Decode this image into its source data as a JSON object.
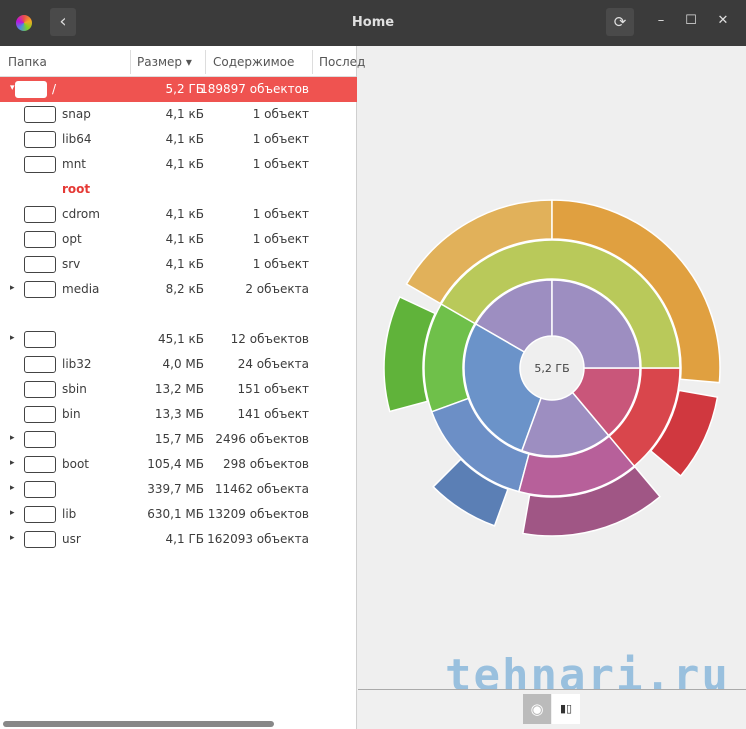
{
  "header": {
    "title": "Home",
    "back_icon": "‹",
    "refresh_icon": "⟳",
    "min": "–",
    "max": "☐",
    "close": "✕"
  },
  "columns": {
    "folder": "Папка",
    "size": "Размер ▾",
    "contents": "Содержимое",
    "modified": "Послед"
  },
  "rows": [
    {
      "name": "/",
      "size": "5,2 ГБ",
      "count": "189897 объектов",
      "expander": "▾",
      "selected": true
    },
    {
      "name": "snap",
      "size": "4,1 кБ",
      "count": "1 объект"
    },
    {
      "name": "lib64",
      "size": "4,1 кБ",
      "count": "1 объект"
    },
    {
      "name": "mnt",
      "size": "4,1 кБ",
      "count": "1 объект"
    },
    {
      "name": "root",
      "size": "",
      "count": "",
      "noicon": true
    },
    {
      "name": "cdrom",
      "size": "4,1 кБ",
      "count": "1 объект"
    },
    {
      "name": "opt",
      "size": "4,1 кБ",
      "count": "1 объект"
    },
    {
      "name": "srv",
      "size": "4,1 кБ",
      "count": "1 объект"
    },
    {
      "name": "media",
      "size": "8,2 кБ",
      "count": "2 объекта",
      "expander": "▸"
    },
    {
      "name": "",
      "size": "",
      "count": "",
      "blank": true
    },
    {
      "name": "",
      "size": "45,1 кБ",
      "count": "12 объектов",
      "expander": "▸"
    },
    {
      "name": "lib32",
      "size": "4,0 МБ",
      "count": "24 объекта"
    },
    {
      "name": "sbin",
      "size": "13,2 МБ",
      "count": "151 объект"
    },
    {
      "name": "bin",
      "size": "13,3 МБ",
      "count": "141 объект"
    },
    {
      "name": "",
      "size": "15,7 МБ",
      "count": "2496 объектов",
      "expander": "▸"
    },
    {
      "name": "boot",
      "size": "105,4 МБ",
      "count": "298 объектов",
      "expander": "▸"
    },
    {
      "name": "",
      "size": "339,7 МБ",
      "count": "11462 объекта",
      "expander": "▸"
    },
    {
      "name": "lib",
      "size": "630,1 МБ",
      "count": "13209 объектов",
      "expander": "▸"
    },
    {
      "name": "usr",
      "size": "4,1 ГБ",
      "count": "162093 объекта",
      "expander": "▸"
    }
  ],
  "chart": {
    "center_label": "5,2 ГБ",
    "rings": [
      [
        {
          "start": 0,
          "end": 90,
          "color": "#9d8ec1"
        },
        {
          "start": 90,
          "end": 140,
          "color": "#c9567a"
        },
        {
          "start": 140,
          "end": 200,
          "color": "#9d8ec1"
        },
        {
          "start": 200,
          "end": 300,
          "color": "#6b93c9"
        },
        {
          "start": 300,
          "end": 360,
          "color": "#9d8ec1"
        }
      ],
      [
        {
          "start": -60,
          "end": 90,
          "color": "#b9c95a"
        },
        {
          "start": 90,
          "end": 140,
          "color": "#d9464c"
        },
        {
          "start": 140,
          "end": 195,
          "color": "#b7609a"
        },
        {
          "start": 195,
          "end": 250,
          "color": "#6c8fc6"
        },
        {
          "start": 250,
          "end": 300,
          "color": "#6fc04a"
        }
      ],
      [
        {
          "start": 0,
          "end": 95,
          "color": "#e0a040"
        },
        {
          "start": -60,
          "end": 0,
          "color": "#e1b15a"
        },
        {
          "start": 100,
          "end": 130,
          "color": "#d0383f"
        },
        {
          "start": 140,
          "end": 190,
          "color": "#a05685"
        },
        {
          "start": 200,
          "end": 225,
          "color": "#5b7fb5"
        },
        {
          "start": 255,
          "end": 295,
          "color": "#60b33a"
        }
      ]
    ]
  },
  "view_buttons": {
    "chart_icon": "◉",
    "treemap_icon": "▮▯"
  },
  "watermark": "tehnari.ru"
}
